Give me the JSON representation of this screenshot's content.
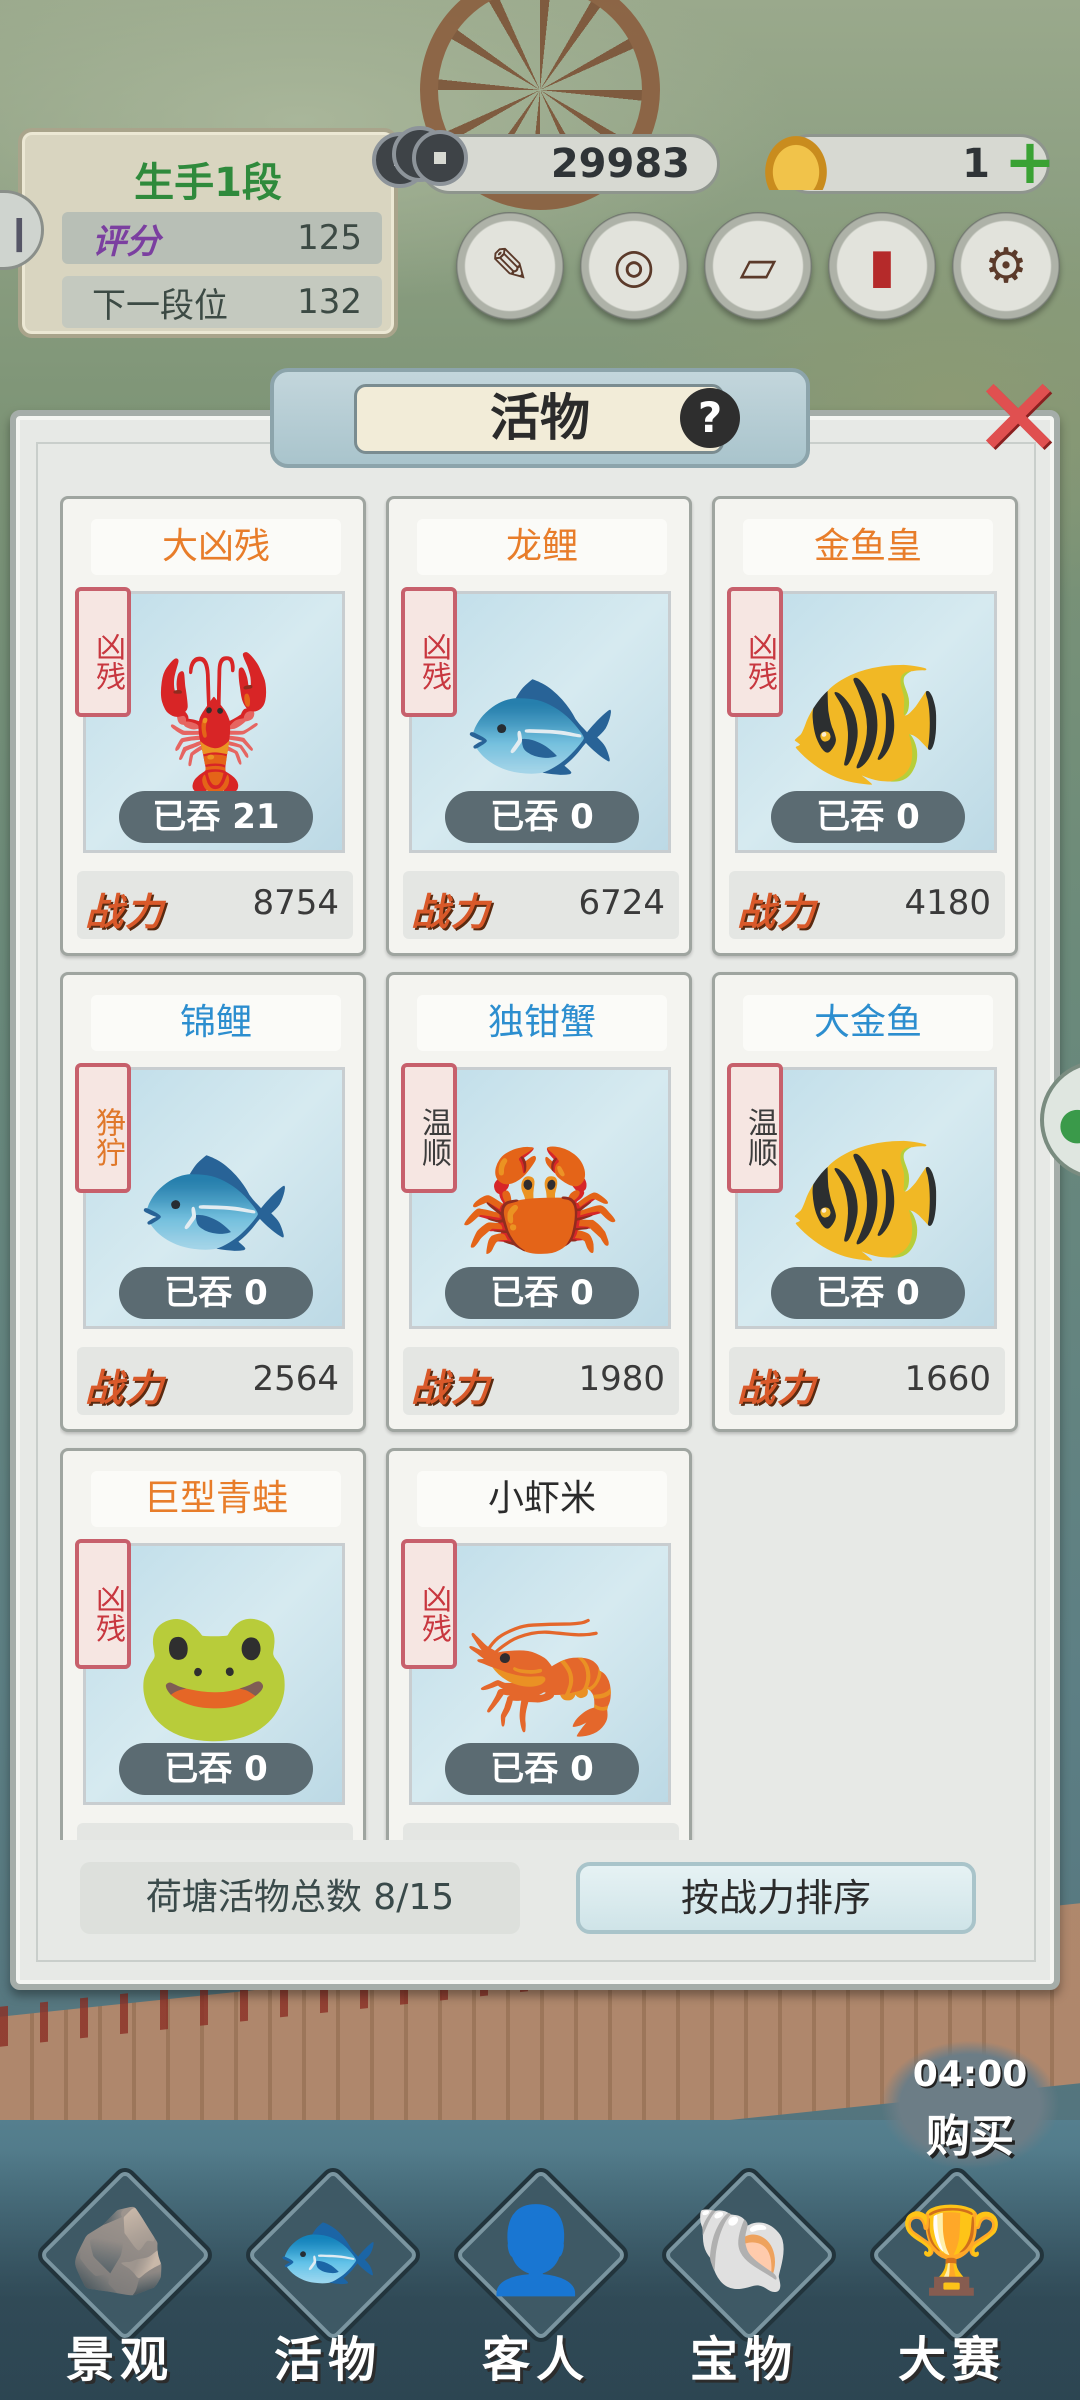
{
  "hud": {
    "rank_title": "生手1段",
    "score_label": "评分",
    "score_value": "125",
    "next_label": "下一段位",
    "next_value": "132",
    "coins": "29983",
    "gold": "1",
    "plus": "+",
    "tools": [
      "scroll-brush-icon",
      "compass-icon",
      "map-icon",
      "book-icon",
      "gear-icon"
    ]
  },
  "panel": {
    "title": "活物",
    "help": "?",
    "close": "✕"
  },
  "cards": [
    {
      "name": "大凶残",
      "name_color": "orange",
      "temper": "凶残",
      "temper_type": "cruel",
      "eaten": "已吞 21",
      "power_label": "战力",
      "power": "8754",
      "creature": "lobster-icon"
    },
    {
      "name": "龙鲤",
      "name_color": "orange",
      "temper": "凶残",
      "temper_type": "cruel",
      "eaten": "已吞 0",
      "power_label": "战力",
      "power": "6724",
      "creature": "koi-icon"
    },
    {
      "name": "金鱼皇",
      "name_color": "orange",
      "temper": "凶残",
      "temper_type": "cruel",
      "eaten": "已吞 0",
      "power_label": "战力",
      "power": "4180",
      "creature": "goldfish-icon"
    },
    {
      "name": "锦鲤",
      "name_color": "blue",
      "temper": "狰狞",
      "temper_type": "fierce",
      "eaten": "已吞 0",
      "power_label": "战力",
      "power": "2564",
      "creature": "koi-icon"
    },
    {
      "name": "独钳蟹",
      "name_color": "blue",
      "temper": "温顺",
      "temper_type": "gentle",
      "eaten": "已吞 0",
      "power_label": "战力",
      "power": "1980",
      "creature": "crab-icon"
    },
    {
      "name": "大金鱼",
      "name_color": "blue",
      "temper": "温顺",
      "temper_type": "gentle",
      "eaten": "已吞 0",
      "power_label": "战力",
      "power": "1660",
      "creature": "goldfish-icon"
    },
    {
      "name": "巨型青蛙",
      "name_color": "orange",
      "temper": "凶残",
      "temper_type": "cruel",
      "eaten": "已吞 0",
      "power_label": "战力",
      "power": "",
      "creature": "frog-icon"
    },
    {
      "name": "小虾米",
      "name_color": "dark",
      "temper": "凶残",
      "temper_type": "cruel",
      "eaten": "已吞 0",
      "power_label": "战力",
      "power": "",
      "creature": "shrimp-icon"
    }
  ],
  "footer": {
    "count_text": "荷塘活物总数 8/15",
    "sort_label": "按战力排序"
  },
  "shop": {
    "timer": "04:00",
    "buy": "购买"
  },
  "nav": [
    {
      "label": "景观",
      "icon": "rock-icon"
    },
    {
      "label": "活物",
      "icon": "fish-icon"
    },
    {
      "label": "客人",
      "icon": "guest-icon"
    },
    {
      "label": "宝物",
      "icon": "shell-icon"
    },
    {
      "label": "大赛",
      "icon": "trophy-icon"
    }
  ]
}
